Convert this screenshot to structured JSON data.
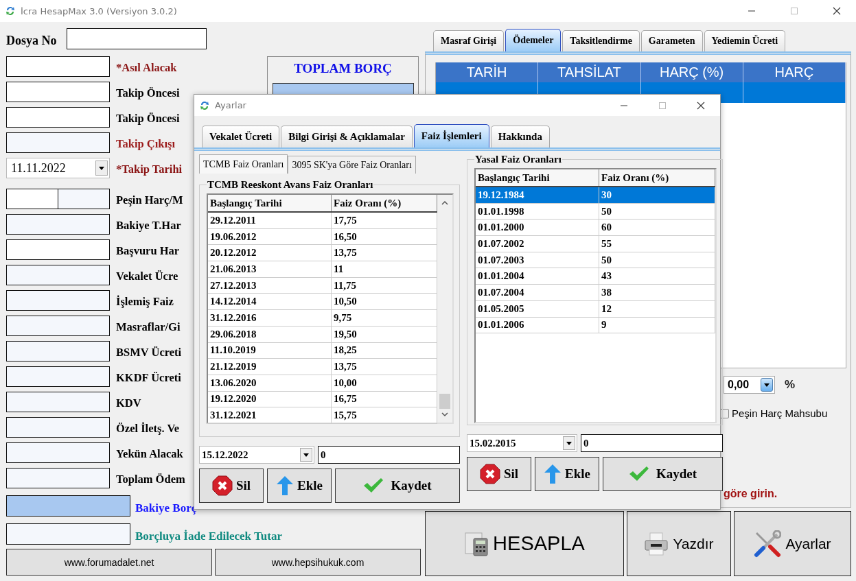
{
  "window": {
    "title": "İcra HesapMax 3.0 (Versiyon 3.0.2)"
  },
  "file_no": {
    "label": "Dosya No"
  },
  "fields": [
    {
      "label": "*Asıl Alacak",
      "kind": "input",
      "color": "#8b1414"
    },
    {
      "label": "Takip Öncesi",
      "kind": "input",
      "color": "#000000"
    },
    {
      "label": "Takip Öncesi",
      "kind": "input",
      "color": "#000000"
    },
    {
      "label": "Takip Çıkışı",
      "kind": "output",
      "color": "#9b1b1b"
    },
    {
      "label": "*Takip Tarihi",
      "kind": "date",
      "value": "11.11.2022",
      "color": "#8b1414"
    },
    {
      "label": "Peşin Harç/M",
      "kind": "split",
      "color": "#000000"
    },
    {
      "label": "Bakiye T.Har",
      "kind": "output",
      "color": "#000000"
    },
    {
      "label": "Başvuru Har",
      "kind": "input",
      "color": "#000000"
    },
    {
      "label": "Vekalet Ücre",
      "kind": "output",
      "color": "#000000"
    },
    {
      "label": "İşlemiş Faiz",
      "kind": "output",
      "color": "#000000"
    },
    {
      "label": "Masraflar/Gi",
      "kind": "output",
      "color": "#000000"
    },
    {
      "label": "BSMV Ücreti",
      "kind": "output",
      "color": "#000000"
    },
    {
      "label": "KKDF Ücreti",
      "kind": "output",
      "color": "#000000"
    },
    {
      "label": "KDV",
      "kind": "output",
      "color": "#000000"
    },
    {
      "label": "Özel İletş. Ve",
      "kind": "output",
      "color": "#000000"
    },
    {
      "label": "Yekün Alacak",
      "kind": "output",
      "color": "#000000"
    },
    {
      "label": "Toplam Ödem",
      "kind": "output",
      "color": "#000000"
    }
  ],
  "total": {
    "title": "TOPLAM BORÇ"
  },
  "balance": {
    "label": "Bakiye Borç"
  },
  "refund": {
    "label": "Borçluya İade Edilecek Tutar"
  },
  "links": [
    "www.forumadalet.net",
    "www.hepsihukuk.com"
  ],
  "tabs": [
    {
      "label": "Masraf Girişi",
      "selected": false
    },
    {
      "label": "Ödemeler",
      "selected": true
    },
    {
      "label": "Taksitlendirme",
      "selected": false
    },
    {
      "label": "Garameten",
      "selected": false
    },
    {
      "label": "Yediemin Ücreti",
      "selected": false
    }
  ],
  "payments": {
    "columns": [
      "TARİH",
      "TAHSİLAT",
      "HARÇ (%)",
      "HARÇ"
    ],
    "rows": [
      {
        "selected": true
      }
    ]
  },
  "rate": {
    "value": "0,00",
    "unit": "%"
  },
  "advance_fee": {
    "label": "Peşin Harç Mahsubu",
    "checked": false
  },
  "hint": "göre girin.",
  "actions": [
    {
      "label": "HESAPLA",
      "kind": "calculate"
    },
    {
      "label": "Yazdır",
      "kind": "print"
    },
    {
      "label": "Ayarlar",
      "kind": "settings"
    }
  ],
  "dialog": {
    "title": "Ayarlar",
    "tabs": [
      {
        "label": "Vekalet Ücreti",
        "selected": false
      },
      {
        "label": "Bilgi Girişi & Açıklamalar",
        "selected": false
      },
      {
        "label": "Faiz İşlemleri",
        "selected": true
      },
      {
        "label": "Hakkında",
        "selected": false
      }
    ],
    "subtabs": [
      {
        "label": "TCMB Faiz Oranları",
        "selected": true
      },
      {
        "label": "3095 SK'ya Göre Faiz Oranları",
        "selected": false
      }
    ],
    "groups": [
      {
        "title": "TCMB Reeskont Avans Faiz Oranları",
        "columns": [
          "Başlangıç Tarihi",
          "Faiz Oranı (%)"
        ],
        "rows": [
          {
            "date": "29.12.2011",
            "rate": "17,75",
            "selected": false
          },
          {
            "date": "19.06.2012",
            "rate": "16,50",
            "selected": false
          },
          {
            "date": "20.12.2012",
            "rate": "13,75",
            "selected": false
          },
          {
            "date": "21.06.2013",
            "rate": "11",
            "selected": false
          },
          {
            "date": "27.12.2013",
            "rate": "11,75",
            "selected": false
          },
          {
            "date": "14.12.2014",
            "rate": "10,50",
            "selected": false
          },
          {
            "date": "31.12.2016",
            "rate": "9,75",
            "selected": false
          },
          {
            "date": "29.06.2018",
            "rate": "19,50",
            "selected": false
          },
          {
            "date": "11.10.2019",
            "rate": "18,25",
            "selected": false
          },
          {
            "date": "21.12.2019",
            "rate": "13,75",
            "selected": false
          },
          {
            "date": "13.06.2020",
            "rate": "10,00",
            "selected": false
          },
          {
            "date": "19.12.2020",
            "rate": "16,75",
            "selected": false
          },
          {
            "date": "31.12.2021",
            "rate": "15,75",
            "selected": false
          }
        ],
        "date": "15.12.2022",
        "value": "0",
        "buttons": [
          {
            "label": "Sil",
            "kind": "delete"
          },
          {
            "label": "Ekle",
            "kind": "add"
          },
          {
            "label": "Kaydet",
            "kind": "save"
          }
        ]
      },
      {
        "title": "Yasal Faiz Oranları",
        "columns": [
          "Başlangıç Tarihi",
          "Faiz Oranı (%)"
        ],
        "rows": [
          {
            "date": "19.12.1984",
            "rate": "30",
            "selected": true
          },
          {
            "date": "01.01.1998",
            "rate": "50",
            "selected": false
          },
          {
            "date": "01.01.2000",
            "rate": "60",
            "selected": false
          },
          {
            "date": "01.07.2002",
            "rate": "55",
            "selected": false
          },
          {
            "date": "01.07.2003",
            "rate": "50",
            "selected": false
          },
          {
            "date": "01.01.2004",
            "rate": "43",
            "selected": false
          },
          {
            "date": "01.07.2004",
            "rate": "38",
            "selected": false
          },
          {
            "date": "01.05.2005",
            "rate": "12",
            "selected": false
          },
          {
            "date": "01.01.2006",
            "rate": "9",
            "selected": false
          }
        ],
        "date": "15.02.2015",
        "value": "0",
        "buttons": [
          {
            "label": "Sil",
            "kind": "delete"
          },
          {
            "label": "Ekle",
            "kind": "add"
          },
          {
            "label": "Kaydet",
            "kind": "save"
          }
        ]
      }
    ]
  }
}
